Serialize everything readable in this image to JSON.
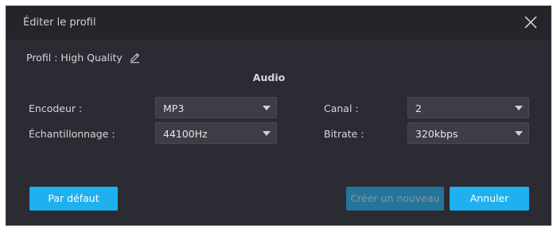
{
  "dialog": {
    "title": "Éditer le profil",
    "close_icon": "close-icon"
  },
  "profile": {
    "label": "Profil",
    "separator": ":",
    "value": "High Quality",
    "edit_icon": "pencil-icon"
  },
  "section": {
    "title": "Audio"
  },
  "fields": {
    "encoder": {
      "label": "Encodeur :",
      "value": "MP3"
    },
    "sample_rate": {
      "label": "Échantillonnage :",
      "value": "44100Hz"
    },
    "channel": {
      "label": "Canal :",
      "value": "2"
    },
    "bitrate": {
      "label": "Bitrate :",
      "value": "320kbps"
    }
  },
  "buttons": {
    "default": "Par défaut",
    "create_new": "Créer un nouveau",
    "cancel": "Annuler"
  },
  "colors": {
    "accent": "#1fb0f0",
    "background": "#2b2b33",
    "titlebar": "#24242b"
  }
}
